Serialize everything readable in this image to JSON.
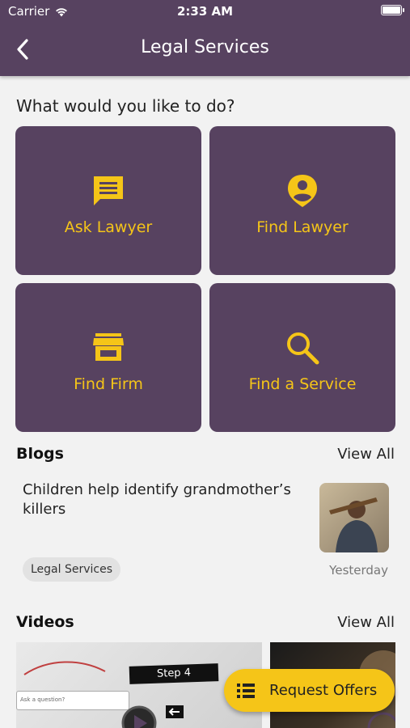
{
  "status_bar": {
    "carrier": "Carrier",
    "time": "2:33 AM"
  },
  "header": {
    "title": "Legal Services"
  },
  "prompt": "What would you like to do?",
  "actions": [
    {
      "label": "Ask Lawyer",
      "icon": "chat-icon"
    },
    {
      "label": "Find Lawyer",
      "icon": "person-pin-icon"
    },
    {
      "label": "Find Firm",
      "icon": "store-icon"
    },
    {
      "label": "Find a Service",
      "icon": "search-icon"
    }
  ],
  "blogs": {
    "title": "Blogs",
    "view_all": "View All",
    "items": [
      {
        "headline": "Children help identify grandmother’s killers",
        "tag": "Legal Services",
        "date": "Yesterday"
      }
    ]
  },
  "videos": {
    "title": "Videos",
    "view_all": "View All",
    "thumb1": {
      "step_label": "Step 4",
      "input_placeholder": "Ask a question?"
    }
  },
  "cta": {
    "label": "Request Offers"
  },
  "colors": {
    "primary": "#574260",
    "accent": "#f5c518",
    "background": "#f2f2f2"
  }
}
